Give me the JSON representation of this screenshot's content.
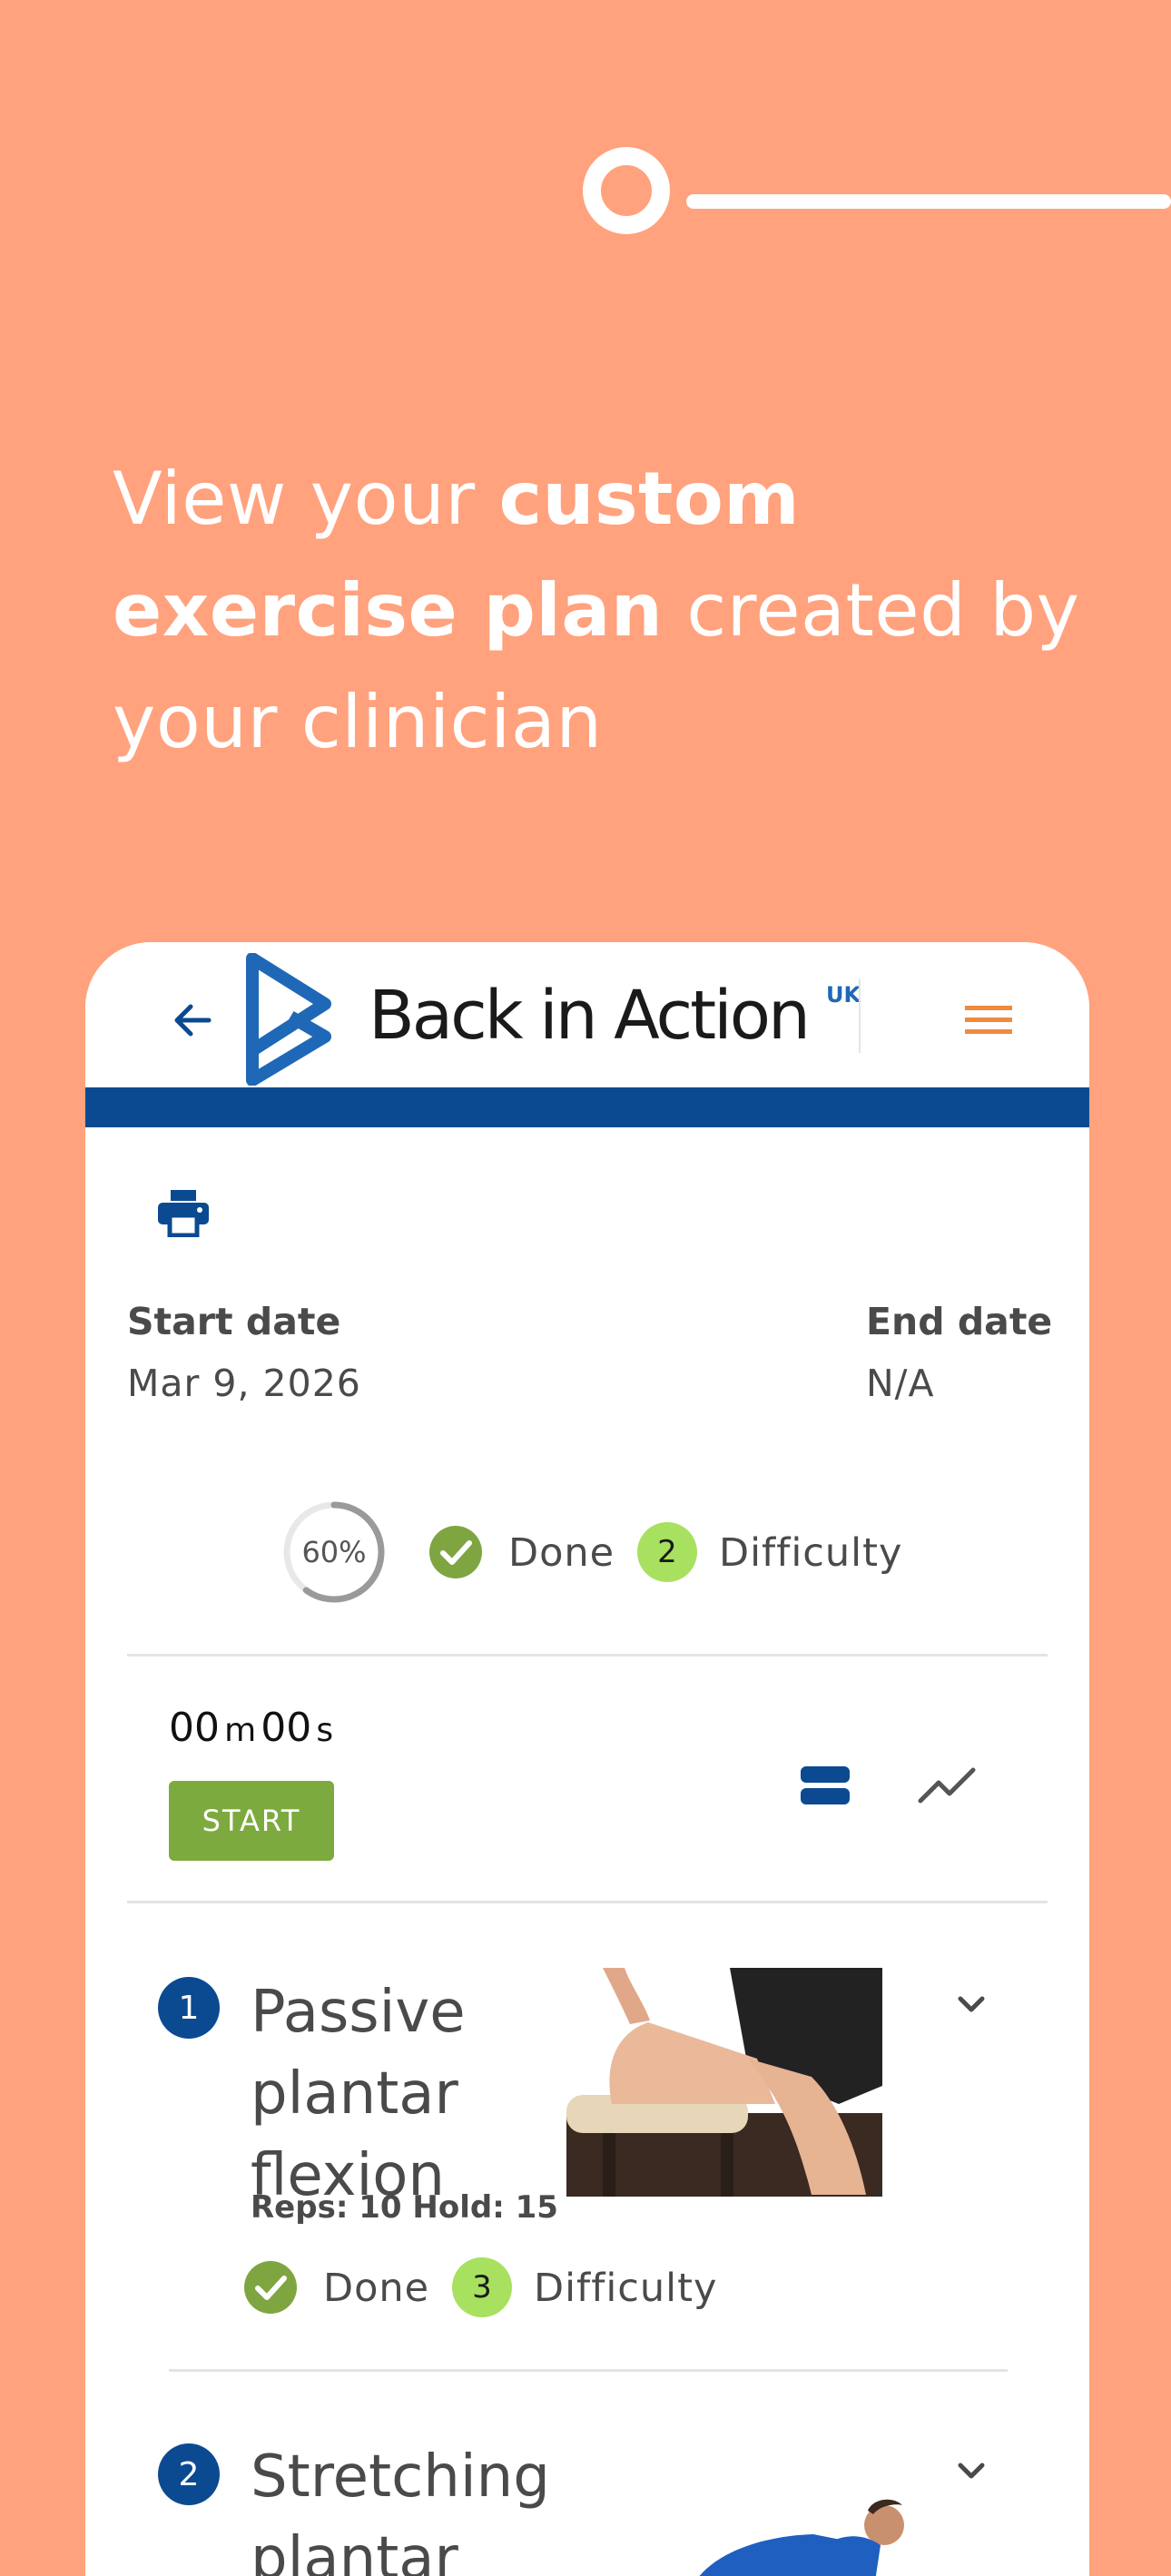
{
  "colors": {
    "background": "#FFA27D",
    "brand_blue": "#0B4A91",
    "accent_orange": "#F08A3E",
    "start_green": "#7DAA3E",
    "difficulty_green": "#A8E05F",
    "done_green": "#7FA541"
  },
  "headline": {
    "part1": "View your ",
    "bold1": "custom exercise plan",
    "part2": " created by your clinician"
  },
  "app": {
    "logo_text": "Back in Action",
    "logo_superscript": "UK",
    "icons": {
      "back": "arrow-left-icon",
      "menu": "hamburger-menu-icon",
      "print": "printer-icon",
      "list": "list-view-icon",
      "chart": "trend-chart-icon"
    }
  },
  "plan": {
    "start_label": "Start date",
    "start_value": "Mar 9, 2026",
    "end_label": "End date",
    "end_value": "N/A",
    "progress_value": 0.6,
    "progress_text": "60%",
    "done_label": "Done",
    "difficulty_value": "2",
    "difficulty_label": "Difficulty"
  },
  "timer": {
    "minutes": "00",
    "minutes_unit": "m",
    "seconds": "00",
    "seconds_unit": "s",
    "start_label": "START"
  },
  "exercises": [
    {
      "number": "1",
      "title": "Passive plantar flexion",
      "meta": "Reps: 10 Hold: 15",
      "done_label": "Done",
      "difficulty_value": "3",
      "difficulty_label": "Difficulty"
    },
    {
      "number": "2",
      "title": "Stretching plantar"
    }
  ]
}
